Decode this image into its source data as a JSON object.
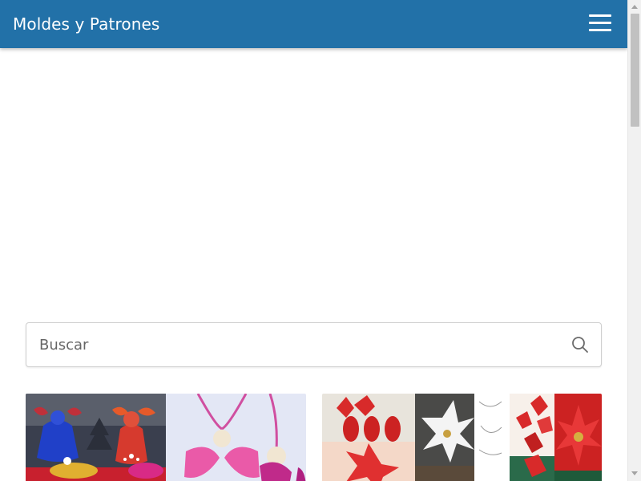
{
  "header": {
    "title": "Moldes y Patrones",
    "menu_icon": "hamburger-menu-icon",
    "background": "#2271a8"
  },
  "search": {
    "placeholder": "Buscar",
    "value": "",
    "icon": "search-icon"
  },
  "colors": {
    "accent": "#2271a8",
    "text": "#ffffff",
    "border": "#cfcfcf"
  }
}
